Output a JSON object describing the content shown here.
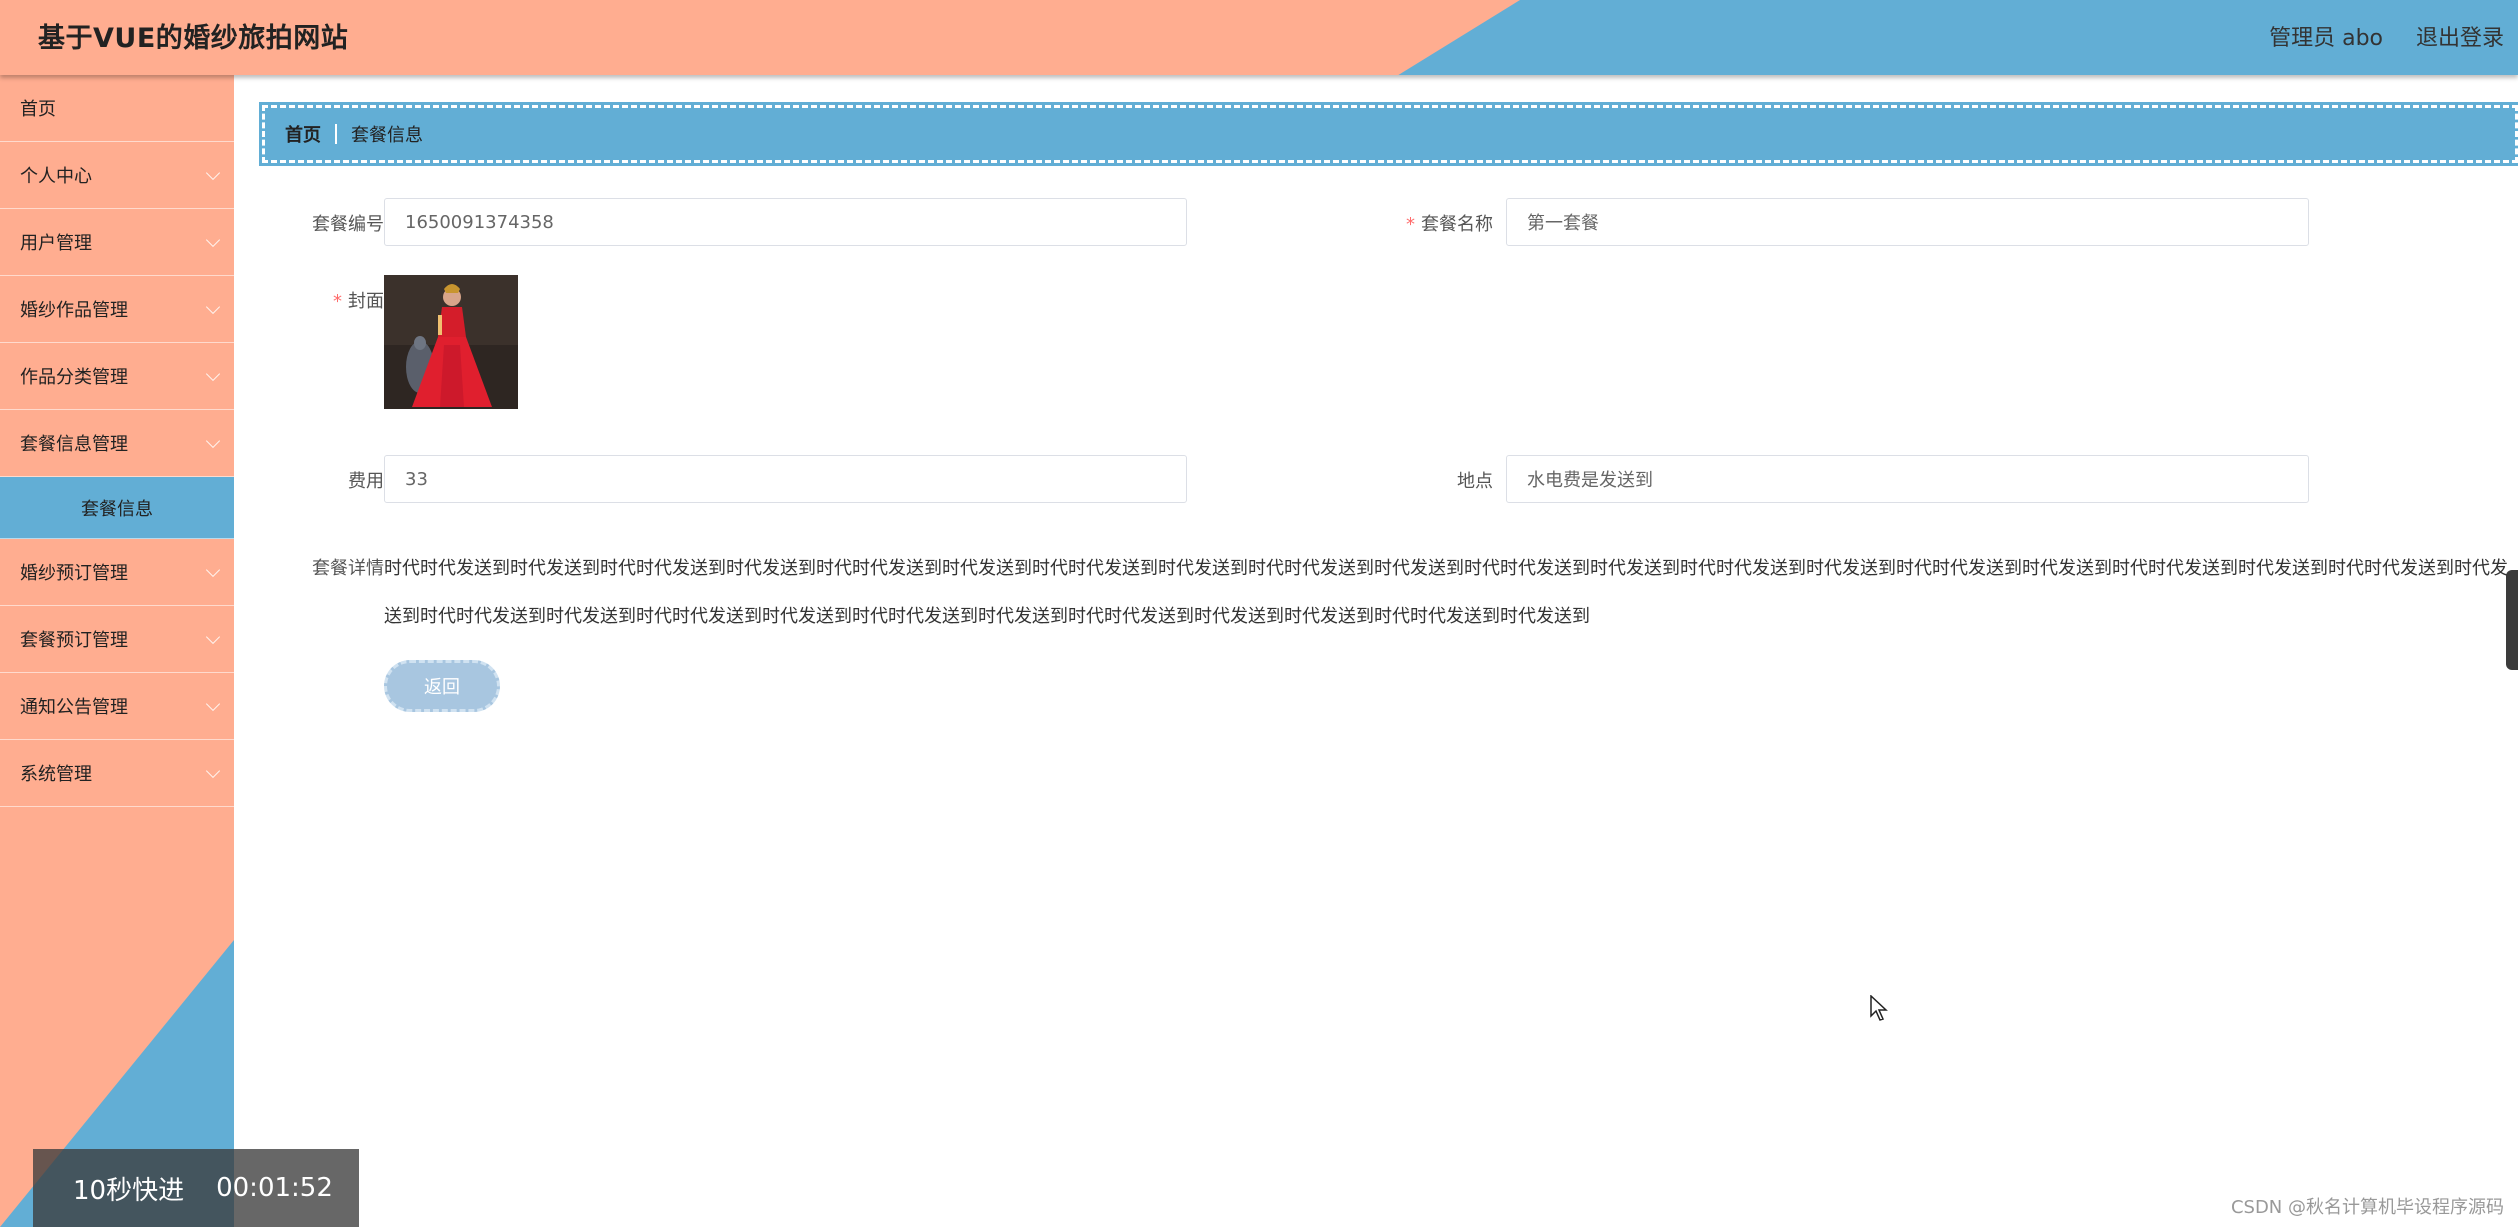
{
  "header": {
    "site_title": "基于VUE的婚纱旅拍网站",
    "user_label": "管理员 abo",
    "logout_label": "退出登录"
  },
  "sidebar": {
    "items": [
      {
        "label": "首页",
        "has_arrow": false
      },
      {
        "label": "个人中心",
        "has_arrow": true
      },
      {
        "label": "用户管理",
        "has_arrow": true
      },
      {
        "label": "婚纱作品管理",
        "has_arrow": true
      },
      {
        "label": "作品分类管理",
        "has_arrow": true
      },
      {
        "label": "套餐信息管理",
        "has_arrow": true
      },
      {
        "label": "套餐信息",
        "sub": true,
        "active": true
      },
      {
        "label": "婚纱预订管理",
        "has_arrow": true
      },
      {
        "label": "套餐预订管理",
        "has_arrow": true
      },
      {
        "label": "通知公告管理",
        "has_arrow": true
      },
      {
        "label": "系统管理",
        "has_arrow": true
      }
    ]
  },
  "breadcrumb": {
    "home": "首页",
    "current": "套餐信息"
  },
  "form": {
    "package_no_label": "套餐编号",
    "package_no_value": "1650091374358",
    "package_name_label": "套餐名称",
    "package_name_value": "第一套餐",
    "cover_label": "封面",
    "fee_label": "费用",
    "fee_value": "33",
    "location_label": "地点",
    "location_value": "水电费是发送到",
    "detail_label": "套餐详情",
    "detail_value": "时代时代发送到时代发送到时代时代发送到时代发送到时代时代发送到时代发送到时代时代发送到时代发送到时代时代发送到时代发送到时代时代发送到时代发送到时代时代发送到时代发送到时代时代发送到时代发送到时代时代发送到时代发送到时代时代发送到时代发送到时代时代发送到时代发送到时代时代发送到时代发送到时代时代发送到时代发送到时代时代发送到时代发送到时代发送到时代时代发送到时代发送到",
    "required_mark": "*",
    "back_label": "返回"
  },
  "video": {
    "fast_forward": "10秒快进",
    "time": "00:01:52"
  },
  "watermark": "CSDN @秋名计算机毕设程序源码",
  "colors": {
    "peach": "#ffad90",
    "blue": "#62aed5",
    "button": "#a8c6e0",
    "required": "#ff6b6b"
  }
}
